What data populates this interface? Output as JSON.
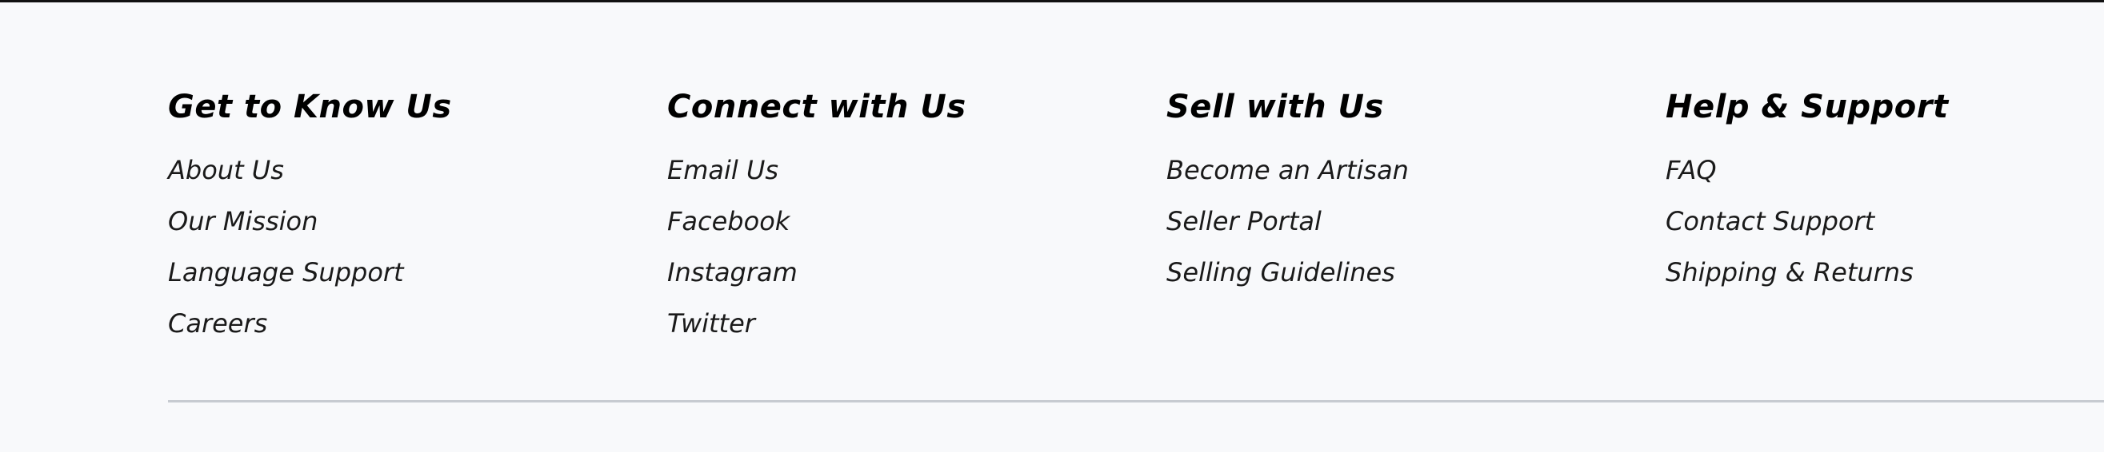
{
  "footer": {
    "columns": [
      {
        "title": "Get to Know Us",
        "links": [
          "About Us",
          "Our Mission",
          "Language Support",
          "Careers"
        ]
      },
      {
        "title": "Connect with Us",
        "links": [
          "Email Us",
          "Facebook",
          "Instagram",
          "Twitter"
        ]
      },
      {
        "title": "Sell with Us",
        "links": [
          "Become an Artisan",
          "Seller Portal",
          "Selling Guidelines"
        ]
      },
      {
        "title": "Help & Support",
        "links": [
          "FAQ",
          "Contact Support",
          "Shipping & Returns"
        ]
      }
    ]
  },
  "colors": {
    "background": "#f8f9fb",
    "text": "#000000",
    "divider": "#c7cbd1",
    "top_border": "#111111"
  }
}
